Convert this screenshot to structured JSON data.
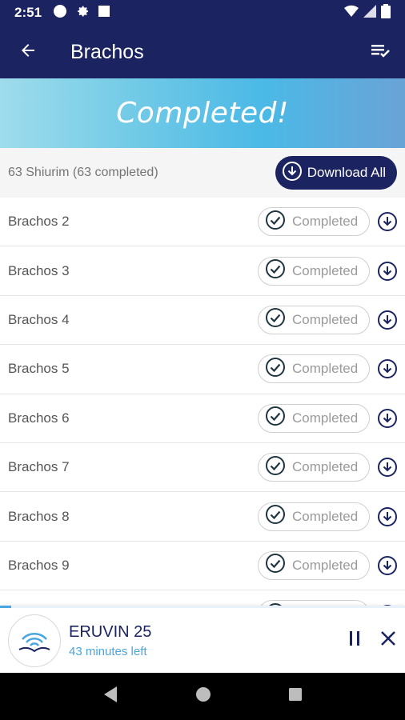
{
  "status_bar": {
    "time": "2:51",
    "left_icons": [
      "circle-icon",
      "gear-icon",
      "square-icon"
    ],
    "right_icons": [
      "wifi-icon",
      "signal-icon",
      "battery-icon"
    ]
  },
  "app_bar": {
    "title": "Brachos",
    "back_icon": "arrow-left-icon",
    "action_icon": "playlist-check-icon"
  },
  "banner": {
    "text": "Completed!"
  },
  "summary": {
    "text": "63 Shiurim (63 completed)",
    "download_all_label": "Download All"
  },
  "items": [
    {
      "title": "Brachos 2",
      "status": "Completed"
    },
    {
      "title": "Brachos 3",
      "status": "Completed"
    },
    {
      "title": "Brachos 4",
      "status": "Completed"
    },
    {
      "title": "Brachos 5",
      "status": "Completed"
    },
    {
      "title": "Brachos 6",
      "status": "Completed"
    },
    {
      "title": "Brachos 7",
      "status": "Completed"
    },
    {
      "title": "Brachos 8",
      "status": "Completed"
    },
    {
      "title": "Brachos 9",
      "status": "Completed"
    },
    {
      "title": "",
      "status": ""
    }
  ],
  "player": {
    "title": "ERUVIN 25",
    "subtitle": "43 minutes left"
  },
  "colors": {
    "primary": "#1b2361",
    "accent": "#4aa6e0",
    "banner_start": "#9fdcec",
    "banner_end": "#6aa3d6"
  }
}
